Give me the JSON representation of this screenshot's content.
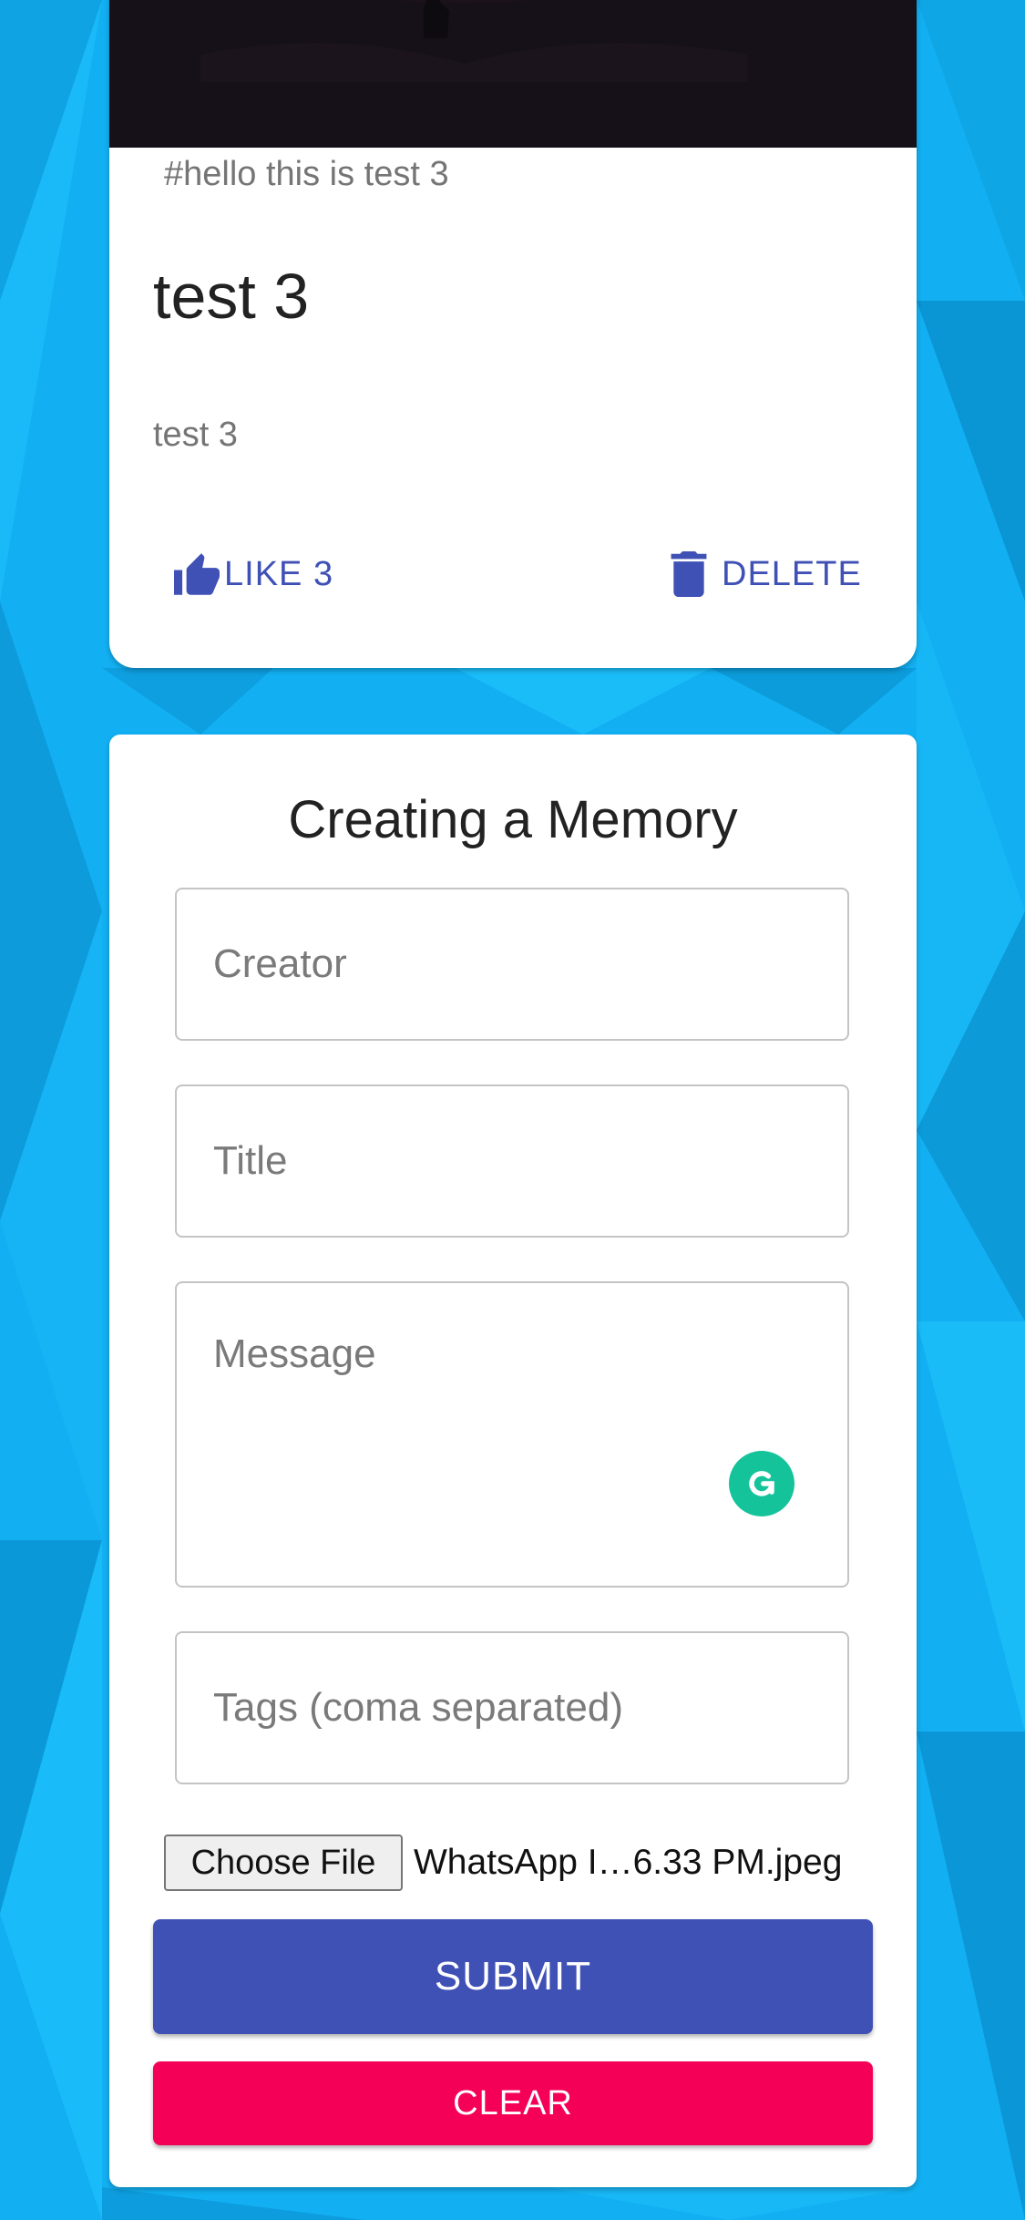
{
  "colors": {
    "background": "#12b0f2",
    "accent": "#3f51b5",
    "clear": "#f50057",
    "grammarly": "#15c39a"
  },
  "post": {
    "tags": "#hello this is test 3",
    "title": "test 3",
    "message": "test 3",
    "like_label": "LIKE 3",
    "delete_label": "DELETE",
    "like_icon": "thumb-up-icon",
    "delete_icon": "trash-icon"
  },
  "form": {
    "title": "Creating a Memory",
    "creator_placeholder": "Creator",
    "title_placeholder": "Title",
    "message_placeholder": "Message",
    "tags_placeholder": "Tags (coma separated)",
    "file_button_label": "Choose File",
    "file_name": "WhatsApp I…6.33 PM.jpeg",
    "submit_label": "SUBMIT",
    "clear_label": "CLEAR"
  }
}
